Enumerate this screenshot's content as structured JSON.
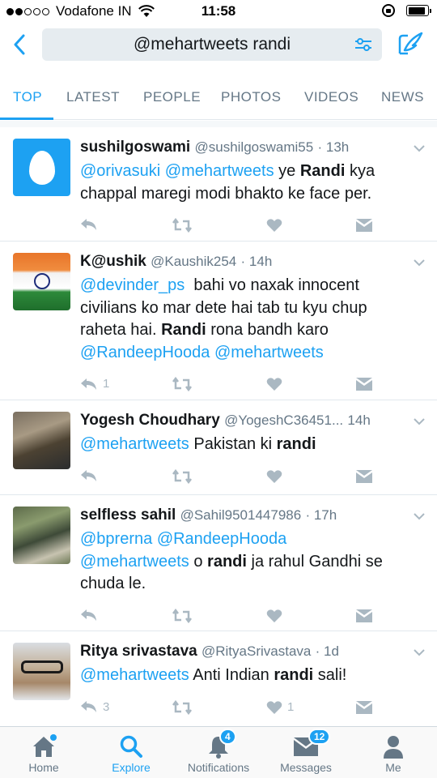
{
  "status_bar": {
    "carrier": "Vodafone IN",
    "time": "11:58",
    "signal_bars": 2,
    "battery_level": 0.9
  },
  "search": {
    "query": "@mehartweets randi"
  },
  "tabs": [
    {
      "label": "TOP",
      "active": true
    },
    {
      "label": "LATEST",
      "active": false
    },
    {
      "label": "PEOPLE",
      "active": false
    },
    {
      "label": "PHOTOS",
      "active": false
    },
    {
      "label": "VIDEOS",
      "active": false
    },
    {
      "label": "NEWS",
      "active": false
    }
  ],
  "tweets": [
    {
      "name": "sushilgoswami",
      "handle": "@sushilgoswami55",
      "time": "· 13h",
      "avatar": "egg-icon",
      "text_lines": [
        [
          {
            "t": "@orivasuki",
            "s": "mention"
          },
          {
            "t": " "
          },
          {
            "t": "@mehartweets",
            "s": "mention"
          },
          {
            "t": " ye "
          },
          {
            "t": "Randi",
            "s": "bold"
          },
          {
            "t": " kya"
          }
        ],
        [
          {
            "t": "chappal maregi modi bhakto ke face per."
          }
        ]
      ],
      "reply_count": "",
      "retweet_count": "",
      "like_count": ""
    },
    {
      "name": "K@ushik",
      "handle": "@Kaushik254",
      "time": "· 14h",
      "avatar": "india-flag",
      "text_lines": [
        [
          {
            "t": "@devinder_ps",
            "s": "mention"
          },
          {
            "t": "  bahi vo naxak innocent"
          }
        ],
        [
          {
            "t": "civilians ko mar dete hai tab tu kyu chup"
          }
        ],
        [
          {
            "t": "raheta hai. "
          },
          {
            "t": "Randi",
            "s": "bold"
          },
          {
            "t": " rona bandh karo"
          }
        ],
        [
          {
            "t": "@RandeepHooda",
            "s": "mention"
          },
          {
            "t": " "
          },
          {
            "t": "@mehartweets",
            "s": "mention"
          }
        ]
      ],
      "reply_count": "1",
      "retweet_count": "",
      "like_count": ""
    },
    {
      "name": "Yogesh Choudhary",
      "handle": "@YogeshC36451...",
      "time": "14h",
      "avatar": "profile-photo",
      "text_lines": [
        [
          {
            "t": "@mehartweets",
            "s": "mention"
          },
          {
            "t": " Pakistan ki "
          },
          {
            "t": "randi",
            "s": "bold"
          }
        ]
      ],
      "reply_count": "",
      "retweet_count": "",
      "like_count": ""
    },
    {
      "name": "selfless sahil",
      "handle": "@Sahil9501447986",
      "time": "· 17h",
      "avatar": "profile-photo",
      "text_lines": [
        [
          {
            "t": "@bprerna",
            "s": "mention"
          },
          {
            "t": " "
          },
          {
            "t": "@RandeepHooda",
            "s": "mention"
          }
        ],
        [
          {
            "t": "@mehartweets",
            "s": "mention"
          },
          {
            "t": " o "
          },
          {
            "t": "randi",
            "s": "bold"
          },
          {
            "t": " ja rahul Gandhi se"
          }
        ],
        [
          {
            "t": "chuda le."
          }
        ]
      ],
      "reply_count": "",
      "retweet_count": "",
      "like_count": ""
    },
    {
      "name": "Ritya srivastava",
      "handle": "@RityaSrivastava",
      "time": "· 1d",
      "avatar": "profile-photo",
      "text_lines": [
        [
          {
            "t": "@mehartweets",
            "s": "mention"
          },
          {
            "t": " Anti Indian "
          },
          {
            "t": "randi",
            "s": "bold"
          },
          {
            "t": " sali!"
          }
        ]
      ],
      "reply_count": "3",
      "retweet_count": "",
      "like_count": "1"
    }
  ],
  "bottom_nav": [
    {
      "label": "Home",
      "icon": "home-icon",
      "active": false,
      "badge": "dot"
    },
    {
      "label": "Explore",
      "icon": "search-icon",
      "active": true,
      "badge": ""
    },
    {
      "label": "Notifications",
      "icon": "bell-icon",
      "active": false,
      "badge": "4"
    },
    {
      "label": "Messages",
      "icon": "envelope-icon",
      "active": false,
      "badge": "12"
    },
    {
      "label": "Me",
      "icon": "person-icon",
      "active": false,
      "badge": ""
    }
  ],
  "colors": {
    "accent": "#1da1f2",
    "text": "#14171a",
    "muted": "#657786",
    "action_icons": "#aab8c2"
  }
}
